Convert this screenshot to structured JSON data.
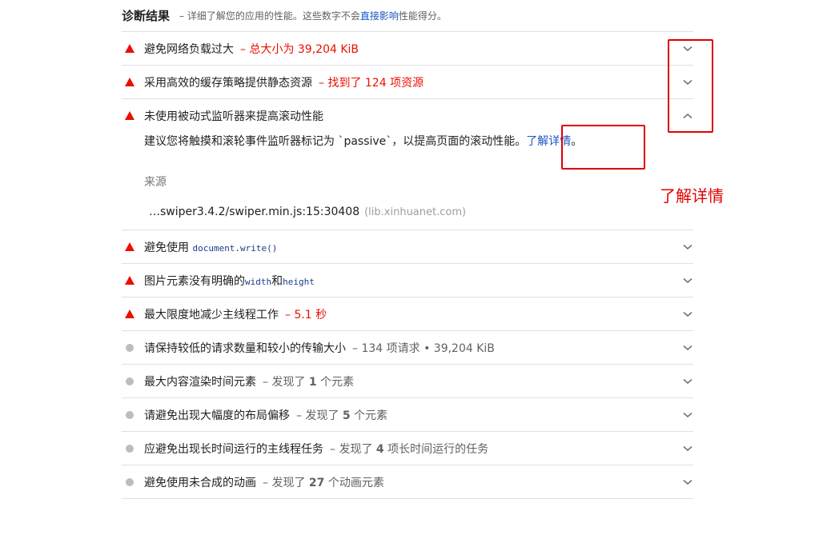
{
  "header": {
    "title": "诊断结果",
    "desc_prefix": "– 详细了解您的应用的性能。这些数字不会",
    "desc_link": "直接影响",
    "desc_suffix": "性能得分。"
  },
  "audits": [
    {
      "status": "fail",
      "title": "避免网络负载过大",
      "separator": "–",
      "summary": "总大小为 39,204 KiB",
      "summary_color": "red",
      "expanded": false
    },
    {
      "status": "fail",
      "title": "采用高效的缓存策略提供静态资源",
      "separator": "–",
      "summary": "找到了 124 项资源",
      "summary_color": "red",
      "expanded": false
    },
    {
      "status": "fail",
      "title": "未使用被动式监听器来提高滚动性能",
      "expanded": true,
      "details": {
        "description": "建议您将触摸和滚轮事件监听器标记为 `passive`，以提高页面的滚动性能。",
        "learn_more": "了解详情",
        "learn_more_suffix": "。",
        "source_header": "来源",
        "source_url": "…swiper3.4.2/swiper.min.js:15:30408",
        "source_host": "(lib.xinhuanet.com)"
      }
    },
    {
      "status": "fail",
      "title_prefix": "避免使用 ",
      "title_code": "document.write()",
      "expanded": false
    },
    {
      "status": "fail",
      "title_prefix": "图片元素没有明确的",
      "title_code1": "width",
      "title_mid": "和",
      "title_code2": "height",
      "expanded": false
    },
    {
      "status": "fail",
      "title": "最大限度地减少主线程工作",
      "separator": "–",
      "summary": "5.1 秒",
      "summary_color": "red",
      "expanded": false
    },
    {
      "status": "info",
      "title": "请保持较低的请求数量和较小的传输大小",
      "separator": "–",
      "summary": "134 项请求 • 39,204 KiB",
      "summary_color": "gray",
      "expanded": false
    },
    {
      "status": "info",
      "title": "最大内容渲染时间元素",
      "separator": "–",
      "summary_pre": "发现了",
      "summary_num": "1",
      "summary_post": "个元素",
      "summary_color": "gray",
      "expanded": false
    },
    {
      "status": "info",
      "title": "请避免出现大幅度的布局偏移",
      "separator": "–",
      "summary_pre": "发现了",
      "summary_num": "5",
      "summary_post": "个元素",
      "summary_color": "gray",
      "expanded": false
    },
    {
      "status": "info",
      "title": "应避免出现长时间运行的主线程任务",
      "separator": "–",
      "summary_pre": "发现了",
      "summary_num": "4",
      "summary_post": "项长时间运行的任务",
      "summary_color": "gray",
      "expanded": false
    },
    {
      "status": "info",
      "title": "避免使用未合成的动画",
      "separator": "–",
      "summary_pre": "发现了",
      "summary_num": "27",
      "summary_post": "个动画元素",
      "summary_color": "gray",
      "expanded": false
    }
  ],
  "annotation": {
    "label": "了解详情",
    "color": "#e00000"
  },
  "colors": {
    "fail": "#eb0f00",
    "info": "#bdbdbd",
    "link": "#1a56c2"
  },
  "icons": {
    "collapsed": "chevron-down-icon",
    "expanded": "chevron-up-icon",
    "fail": "warning-triangle-icon",
    "info": "info-circle-icon"
  }
}
